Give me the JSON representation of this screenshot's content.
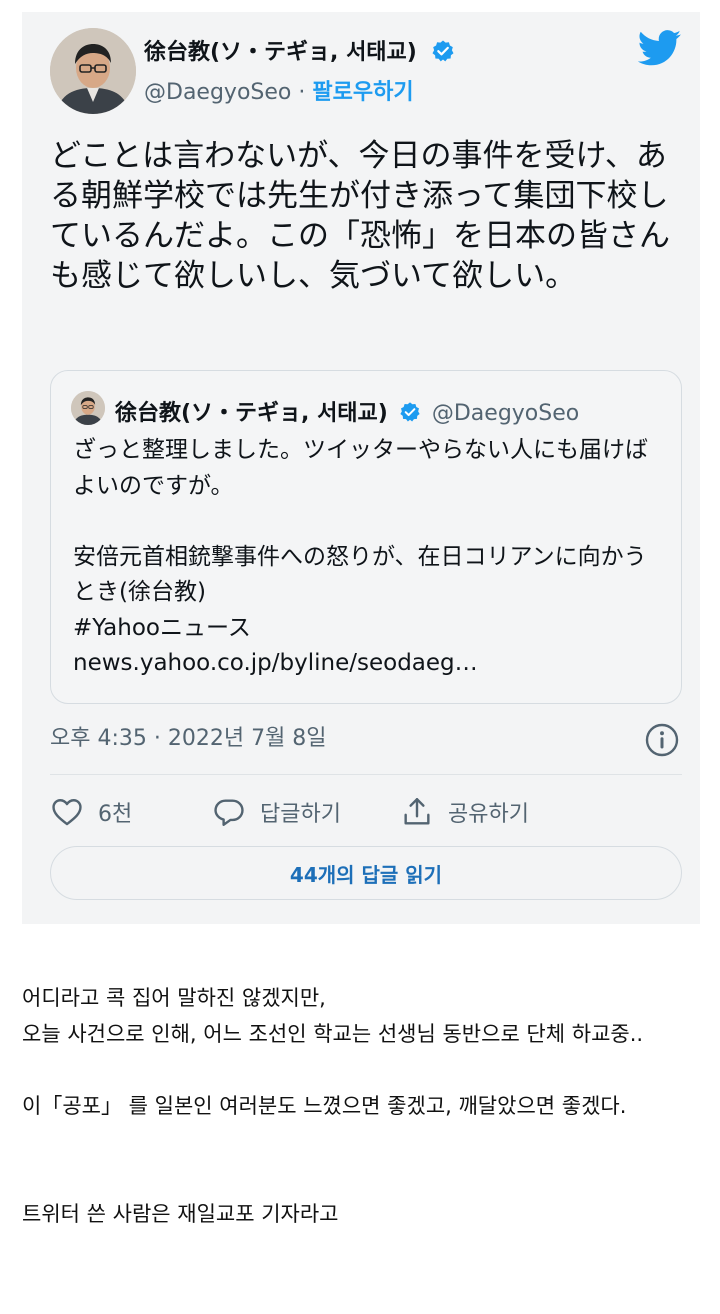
{
  "tweet": {
    "author_name": "徐台教(ソ・テギョ, 서태교)",
    "handle": "@DaegyoSeo",
    "separator": " · ",
    "follow_label": "팔로우하기",
    "text": "どことは言わないが、今日の事件を受け、ある朝鮮学校では先生が付き添って集団下校しているんだよ。この「恐怖」を日本の皆さんも感じて欲しいし、気づいて欲しい。",
    "quote": {
      "author_name": "徐台教(ソ・テギョ, 서태교)",
      "handle": "@DaegyoSeo",
      "text": "ざっと整理しました。ツイッターやらない人にも届けばよいのですが。\n\n安倍元首相銃撃事件への怒りが、在日コリアンに向かうとき(徐台教)\n#Yahooニュース\nnews.yahoo.co.jp/byline/seodaeg…"
    },
    "timestamp": "오후 4:35 · 2022년 7월 8일",
    "like_count": "6천",
    "reply_label": "답글하기",
    "share_label": "공유하기",
    "read_replies_label": "44개의 답글 읽기"
  },
  "post_body": {
    "line1": "어디라고 콕 집어 말하진 않겠지만,",
    "line2": "오늘 사건으로 인해, 어느 조선인 학교는 선생님 동반으로 단체 하교중..",
    "line3": "이「공포」 를 일본인 여러분도 느꼈으면 좋겠고, 깨달았으면 좋겠다.",
    "line4": "트위터 쓴 사람은 재일교포 기자라고"
  },
  "colors": {
    "twitter_blue": "#1d9bf0",
    "card_bg": "#f3f4f5",
    "secondary_text": "#536471"
  },
  "icons": [
    "verified-badge-icon",
    "twitter-bird-icon",
    "info-icon",
    "heart-icon",
    "reply-bubble-icon",
    "share-icon"
  ]
}
